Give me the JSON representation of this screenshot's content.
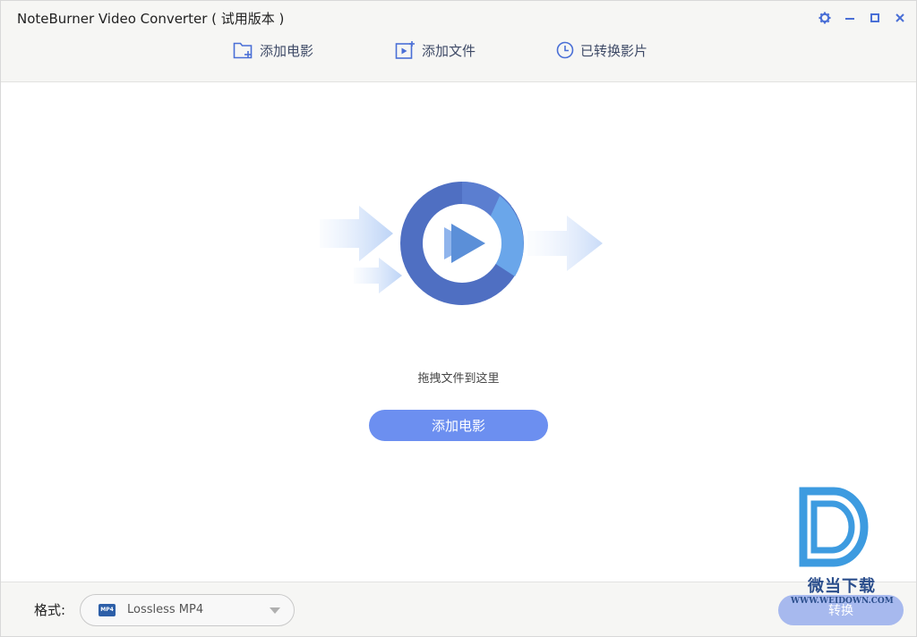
{
  "window": {
    "title": "NoteBurner Video Converter ( 试用版本 )"
  },
  "toolbar": {
    "add_movie_label": "添加电影",
    "add_file_label": "添加文件",
    "converted_label": "已转换影片"
  },
  "main": {
    "drop_hint": "拖拽文件到这里",
    "add_movie_button": "添加电影"
  },
  "footer": {
    "format_label": "格式:",
    "format_value": "Lossless MP4",
    "format_icon_text": "MP4",
    "convert_button": "转换"
  },
  "watermark": {
    "name": "微当下载",
    "url": "WWW.WEIDOWN.COM"
  },
  "colors": {
    "accent": "#6c8ff0",
    "convert_disabled": "#a7b9ee",
    "toolbar_icon": "#4a6fd6"
  }
}
